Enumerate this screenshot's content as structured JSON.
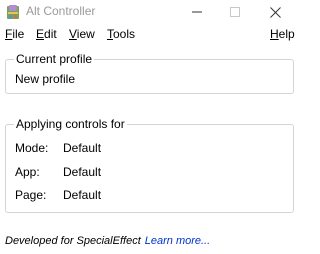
{
  "window": {
    "title": "Alt Controller",
    "app_icon": "alt-controller-app-icon",
    "minimize_icon": "minimize-icon",
    "maximize_icon": "maximize-icon",
    "close_icon": "close-icon"
  },
  "menu": {
    "file": {
      "accel": "F",
      "rest": "ile"
    },
    "edit": {
      "accel": "E",
      "rest": "dit"
    },
    "view": {
      "accel": "V",
      "rest": "iew"
    },
    "tools": {
      "accel": "T",
      "rest": "ools"
    },
    "help": {
      "accel": "H",
      "rest": "elp"
    }
  },
  "current_profile": {
    "legend": "Current profile",
    "name": "New profile"
  },
  "applying_controls": {
    "legend": "Applying controls for",
    "rows": [
      {
        "label": "Mode:",
        "value": "Default"
      },
      {
        "label": "App:",
        "value": "Default"
      },
      {
        "label": "Page:",
        "value": "Default"
      }
    ]
  },
  "footer": {
    "text": "Developed for SpecialEffect",
    "link": "Learn more..."
  },
  "colors": {
    "title_text": "#9a9a9a",
    "group_border": "#d4d4d4",
    "link": "#0033cc",
    "background": "#ffffff"
  }
}
